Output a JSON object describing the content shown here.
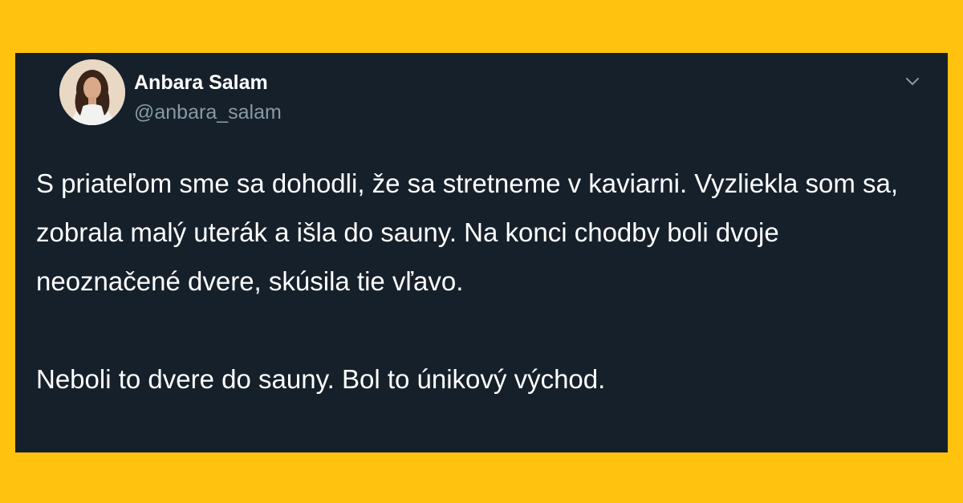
{
  "colors": {
    "frame_background": "#FFC20E",
    "card_background": "#15202B",
    "name_text": "#FFFFFF",
    "handle_text": "#8899A6",
    "body_text": "#FFFFFF"
  },
  "tweet": {
    "author": {
      "display_name": "Anbara Salam",
      "handle": "@anbara_salam",
      "avatar_icon": "profile-photo"
    },
    "more_icon": "chevron-down-icon",
    "paragraphs": [
      "S priateľom sme sa dohodli, že sa stretneme v kaviarni. Vyzliekla som sa, zobrala malý uterák a išla do sauny. Na konci chodby boli dvoje neoznačené dvere, skúsila tie vľavo.",
      "Neboli to dvere do sauny. Bol to únikový východ."
    ]
  }
}
